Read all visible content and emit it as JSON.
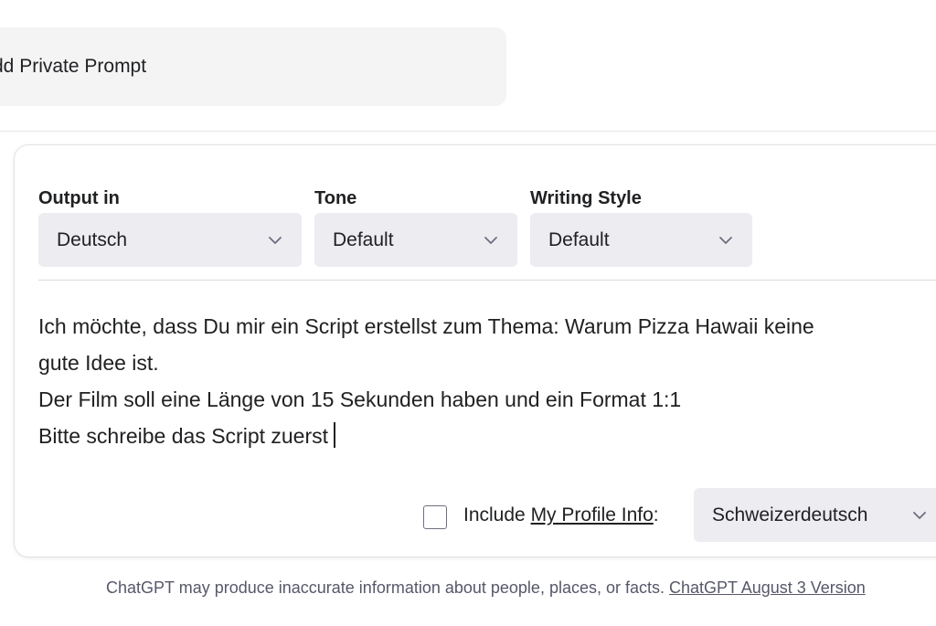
{
  "add_private_prompt": {
    "label": "dd Private Prompt"
  },
  "settings": {
    "output_in": {
      "label": "Output in",
      "value": "Deutsch"
    },
    "tone": {
      "label": "Tone",
      "value": "Default"
    },
    "writing_style": {
      "label": "Writing Style",
      "value": "Default"
    }
  },
  "prompt": {
    "lines": [
      "Ich möchte, dass Du mir ein Script erstellst zum Thema: Warum Pizza Hawaii keine",
      "gute Idee ist.",
      "Der Film soll eine Länge von 15 Sekunden haben und ein Format 1:1",
      "Bitte schreibe das Script zuerst"
    ]
  },
  "profile": {
    "checked": false,
    "include_prefix": "Include ",
    "link_text": "My Profile Info",
    "suffix": ":",
    "selected_profile": "Schweizerdeutsch"
  },
  "footer": {
    "text": "ChatGPT may produce inaccurate information about people, places, or facts. ",
    "link_text": "ChatGPT August 3 Version"
  },
  "icons": {
    "dropdown": "chevron-down-icon",
    "caret": "text-caret"
  },
  "colors": {
    "select_bg": "#ececf1",
    "card_bg": "#f4f4f5",
    "text": "#202123",
    "muted_text": "#565869"
  }
}
